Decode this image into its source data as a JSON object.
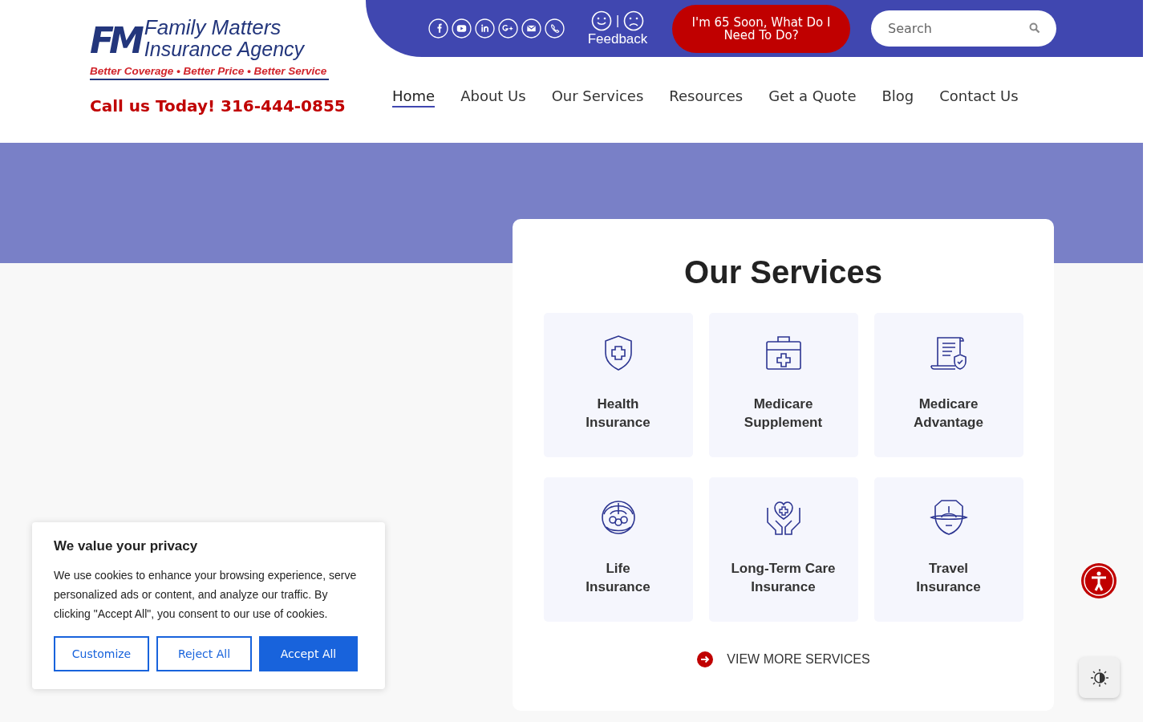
{
  "logo": {
    "mark": "FM",
    "name_line1": "Family Matters",
    "name_line2": "Insurance Agency",
    "tagline": "Better Coverage • Better Price • Better Service"
  },
  "phone": "Call us Today! 316-444-0855",
  "social": [
    {
      "kind": "facebook"
    },
    {
      "kind": "youtube"
    },
    {
      "kind": "linkedin"
    },
    {
      "kind": "googleplus"
    },
    {
      "kind": "email"
    },
    {
      "kind": "phone"
    }
  ],
  "feedback": {
    "label": "Feedback",
    "divider": "|"
  },
  "cta_button": "I'm 65 Soon, What Do I Need To Do?",
  "search": {
    "placeholder": "Search"
  },
  "nav": [
    {
      "label": "Home",
      "selected": true
    },
    {
      "label": "About Us",
      "selected": false
    },
    {
      "label": "Our Services",
      "selected": false
    },
    {
      "label": "Resources",
      "selected": false
    },
    {
      "label": "Get a Quote",
      "selected": false
    },
    {
      "label": "Blog",
      "selected": false
    },
    {
      "label": "Contact Us",
      "selected": false
    }
  ],
  "services": {
    "title": "Our Services",
    "items": [
      {
        "kind": "shield",
        "label_line1": "Health",
        "label_line2": "Insurance"
      },
      {
        "kind": "kit",
        "label_line1": "Medicare",
        "label_line2": "Supplement"
      },
      {
        "kind": "document",
        "label_line1": "Medicare",
        "label_line2": "Advantage"
      },
      {
        "kind": "umbrella",
        "label_line1": "Life",
        "label_line2": "Insurance"
      },
      {
        "kind": "hands",
        "label_line1": "Long-Term Care",
        "label_line2": "Insurance"
      },
      {
        "kind": "travel",
        "label_line1": "Travel",
        "label_line2": "Insurance"
      }
    ],
    "more_link": "VIEW MORE SERVICES"
  },
  "cookie": {
    "title": "We value your privacy",
    "text": "We use cookies to enhance your browsing experience, serve personalized ads or content, and analyze our traffic. By clicking \"Accept All\", you consent to our use of cookies.",
    "buttons": [
      {
        "label": "Customize",
        "kind": "outline"
      },
      {
        "label": "Reject All",
        "kind": "outline"
      },
      {
        "label": "Accept All",
        "kind": "primary"
      }
    ]
  }
}
